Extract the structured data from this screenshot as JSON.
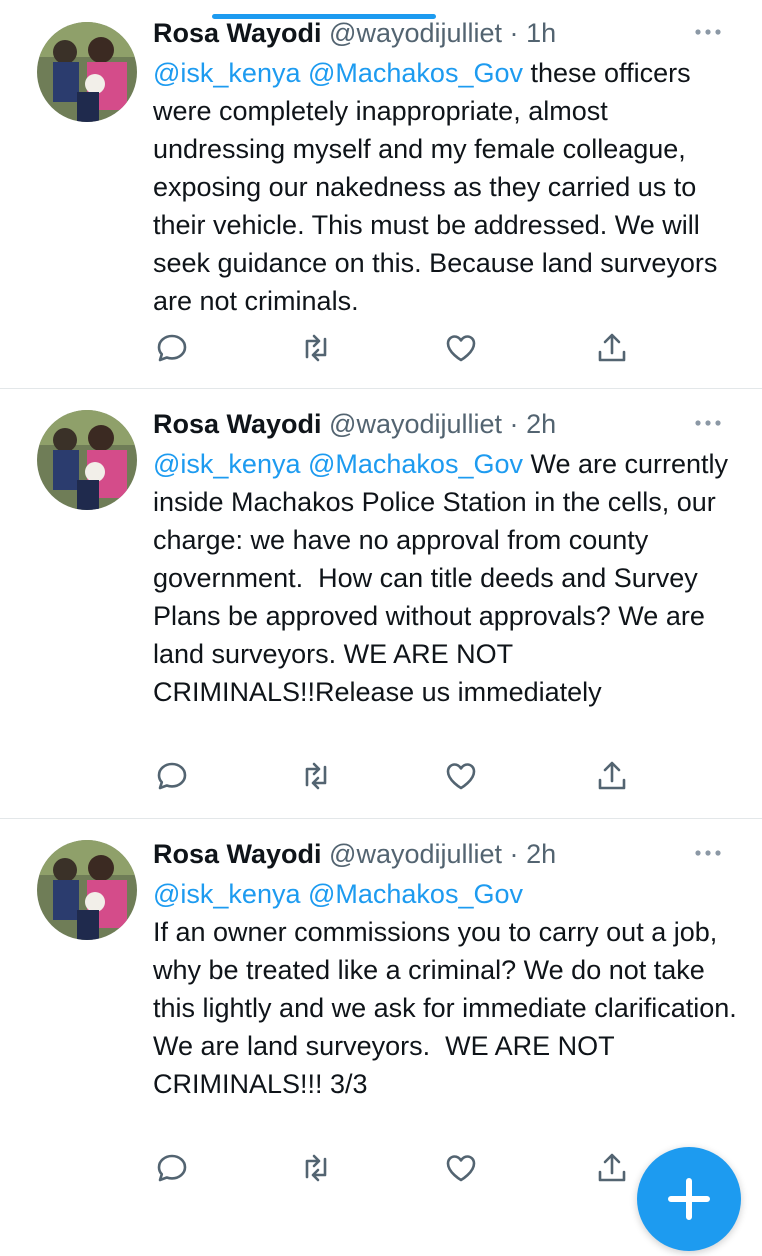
{
  "tweets": [
    {
      "name": "Rosa Wayodi",
      "handle": "@wayodijulliet",
      "separator": "·",
      "time": "1h",
      "mentions": "@isk_kenya @Machakos_Gov",
      "text": " these officers were completely inappropriate, almost undressing myself and my female colleague, exposing our nakedness as they carried us to their vehicle. This must be addressed. We will seek guidance on this. Because land surveyors are not criminals."
    },
    {
      "name": "Rosa Wayodi",
      "handle": "@wayodijulliet",
      "separator": "·",
      "time": "2h",
      "mentions": "@isk_kenya @Machakos_Gov",
      "text": " We are currently inside Machakos Police Station in the cells, our charge: we have no approval from county government.  How can title deeds and Survey Plans be approved without approvals? We are land surveyors. WE ARE NOT CRIMINALS!!Release us immediately"
    },
    {
      "name": "Rosa Wayodi",
      "handle": "@wayodijulliet",
      "separator": "·",
      "time": "2h",
      "mentions": "@isk_kenya @Machakos_Gov",
      "text": "\nIf an owner commissions you to carry out a job,  why be treated like a criminal? We do not take this lightly and we ask for immediate clarification.\nWe are land surveyors.  WE ARE NOT CRIMINALS!!! 3/3"
    }
  ],
  "icons": {
    "reply": "reply-icon",
    "retweet": "retweet-icon",
    "like": "like-icon",
    "share": "share-icon",
    "more": "more-icon",
    "compose": "compose-plus-icon"
  },
  "colors": {
    "accent": "#1d9bf0",
    "secondary_text": "#536471",
    "primary_text": "#0f1419"
  }
}
